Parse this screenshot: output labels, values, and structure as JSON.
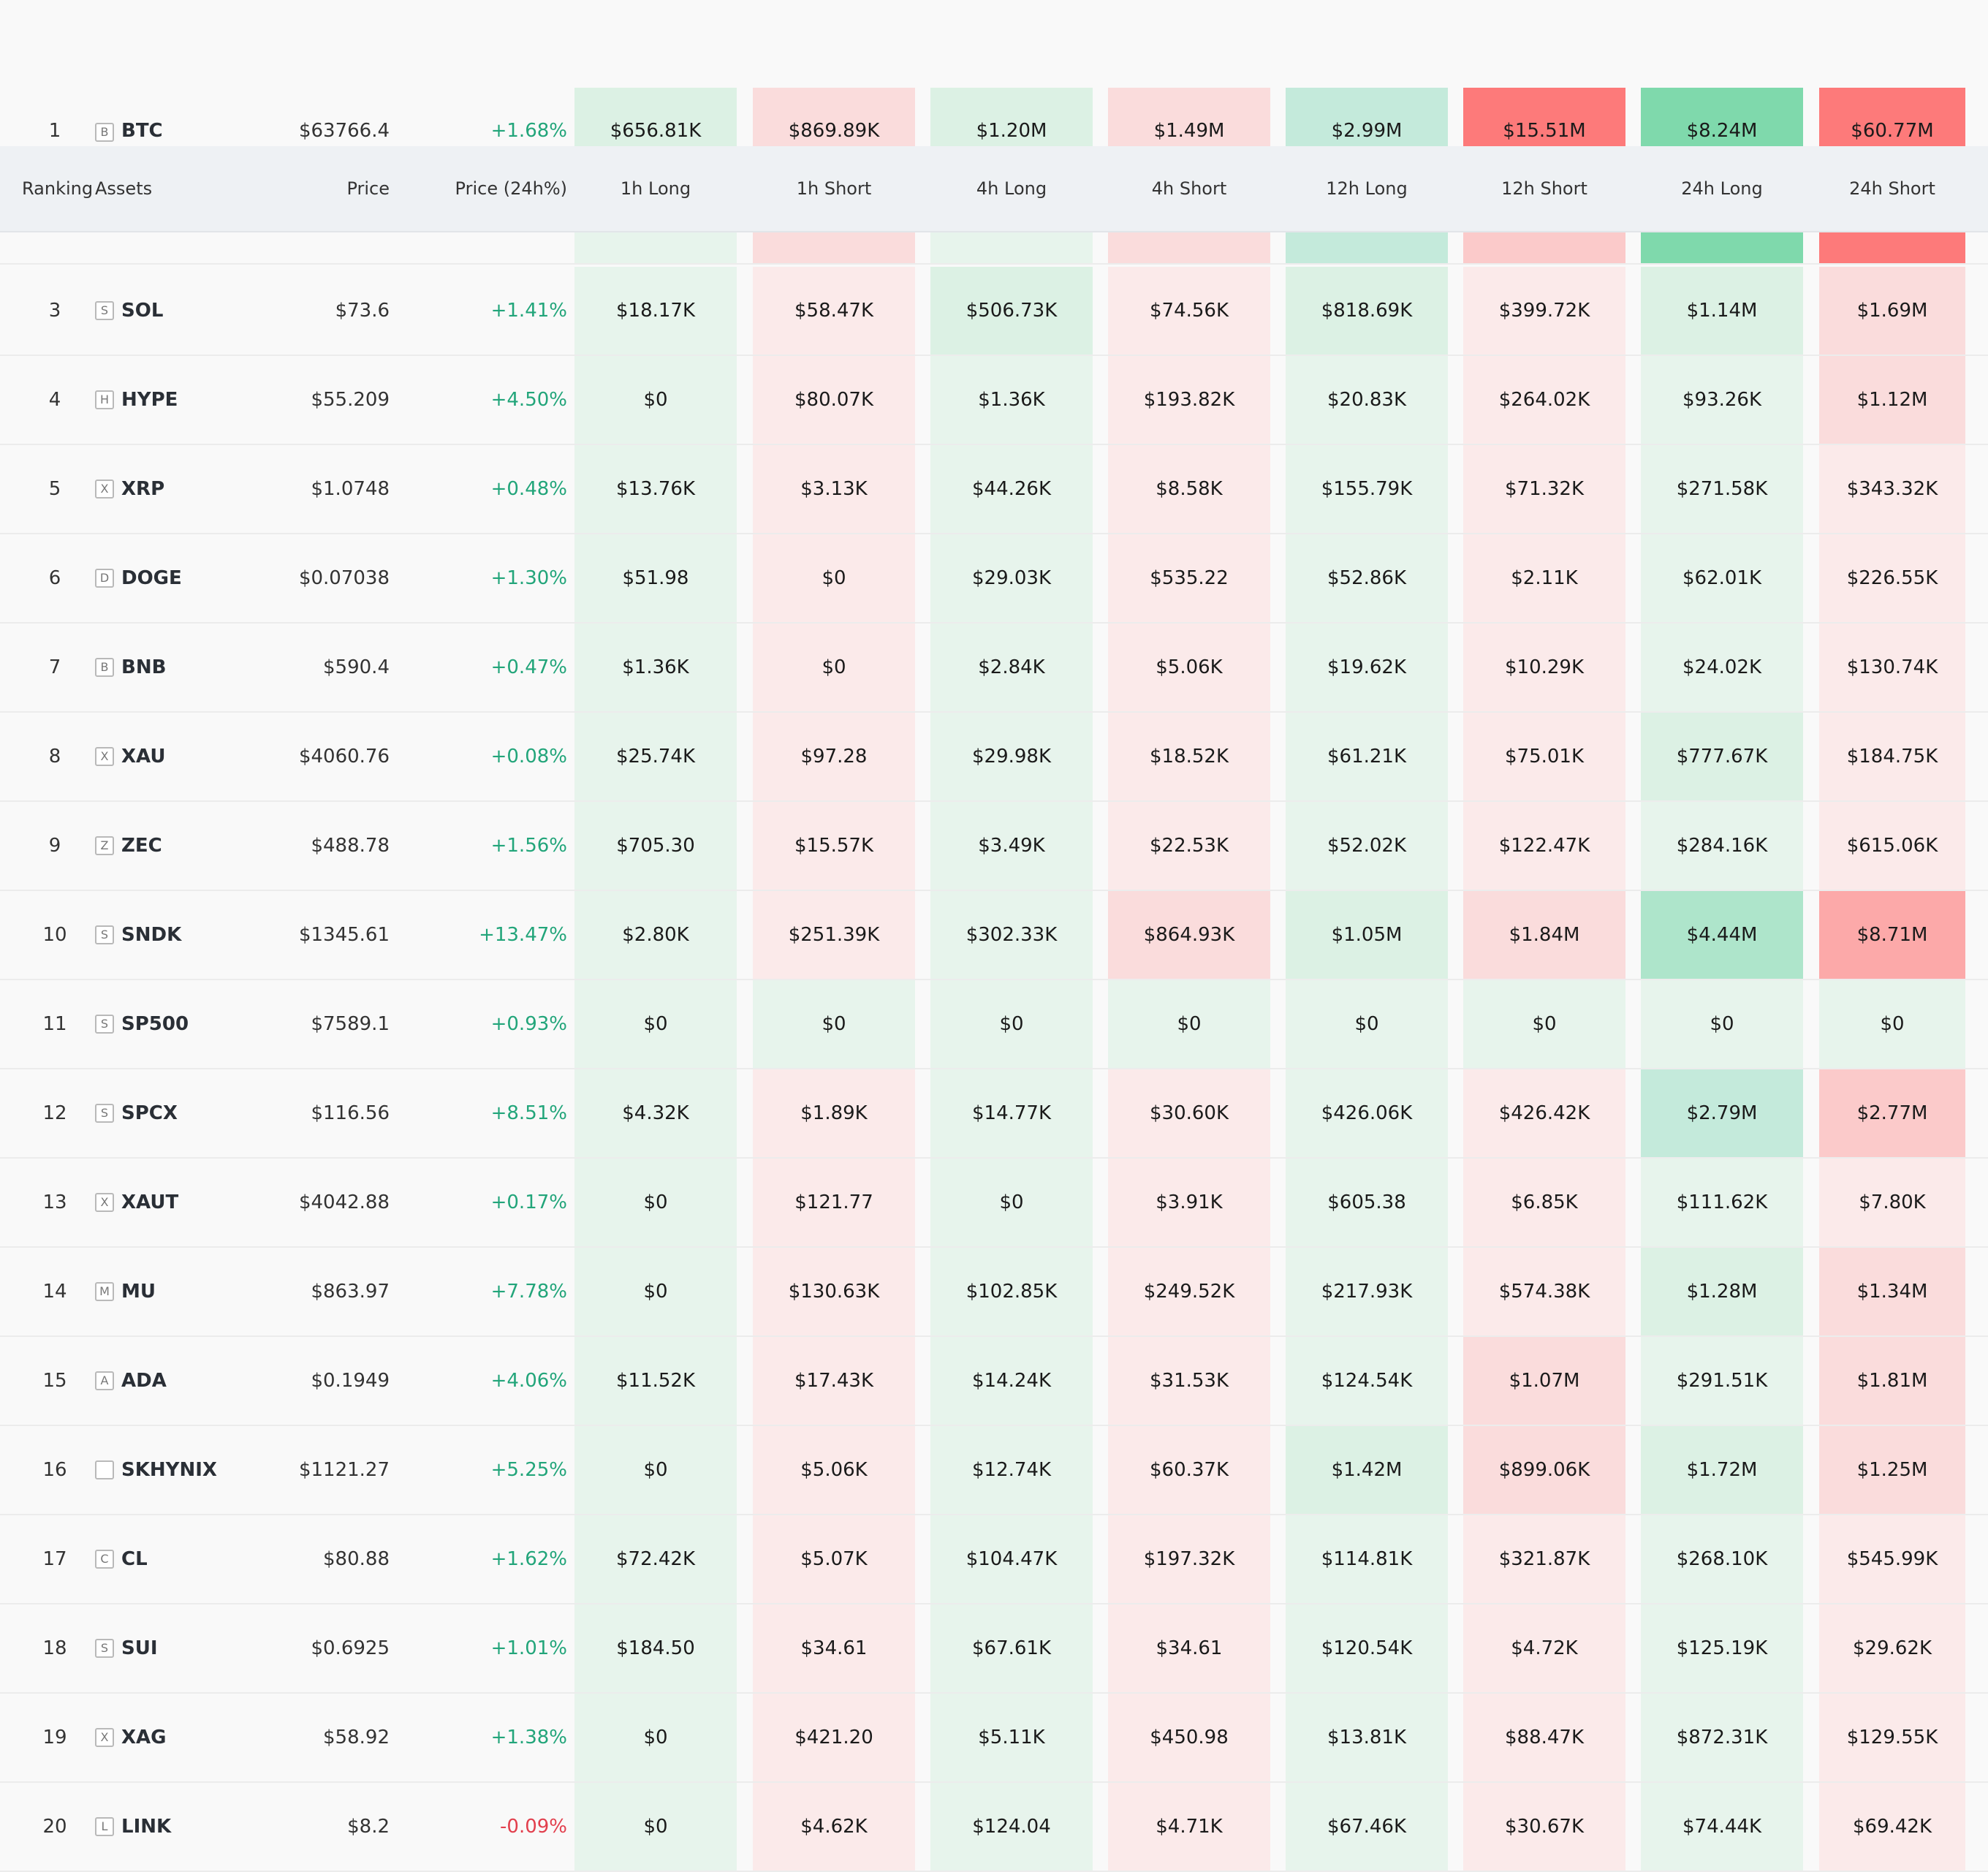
{
  "header": {
    "ranking": "Ranking",
    "assets": "Assets",
    "price": "Price",
    "price_change": "Price (24h%)",
    "h1_long": "1h Long",
    "h1_short": "1h Short",
    "h4_long": "4h Long",
    "h4_short": "4h Short",
    "h12_long": "12h Long",
    "h12_short": "12h Short",
    "h24_long": "24h Long",
    "h24_short": "24h Short"
  },
  "colors": {
    "long_fills": [
      "#e7f4ec",
      "#dcf1e4",
      "#c4eadb",
      "#aee5cb",
      "#7fd9ac"
    ],
    "short_fills": [
      "#fbeaea",
      "#fadcdc",
      "#fbcaca",
      "#fca9a9",
      "#fd7a7a"
    ],
    "positive": "#22a57a",
    "negative": "#e23f4d"
  },
  "rows": [
    {
      "rank": "1",
      "logo": "B",
      "symbol": "BTC",
      "price": "$63766.4",
      "change": "+1.68%",
      "dir": "up",
      "values": [
        "$656.81K",
        "$869.89K",
        "$1.20M",
        "$1.49M",
        "$2.99M",
        "$15.51M",
        "$8.24M",
        "$60.77M"
      ],
      "shade": [
        1,
        1,
        1,
        1,
        2,
        4,
        4,
        4
      ]
    },
    {
      "rank": "",
      "logo": "",
      "symbol": "",
      "price": "",
      "change": "",
      "dir": "up",
      "values": [
        "",
        "",
        "",
        "",
        "",
        "",
        "",
        ""
      ],
      "shade": [
        0,
        1,
        0,
        1,
        2,
        2,
        4,
        4
      ]
    },
    {
      "rank": "3",
      "logo": "S",
      "symbol": "SOL",
      "price": "$73.6",
      "change": "+1.41%",
      "dir": "up",
      "values": [
        "$18.17K",
        "$58.47K",
        "$506.73K",
        "$74.56K",
        "$818.69K",
        "$399.72K",
        "$1.14M",
        "$1.69M"
      ],
      "shade": [
        0,
        0,
        1,
        0,
        1,
        0,
        1,
        1
      ]
    },
    {
      "rank": "4",
      "logo": "H",
      "symbol": "HYPE",
      "price": "$55.209",
      "change": "+4.50%",
      "dir": "up",
      "values": [
        "$0",
        "$80.07K",
        "$1.36K",
        "$193.82K",
        "$20.83K",
        "$264.02K",
        "$93.26K",
        "$1.12M"
      ],
      "shade": [
        0,
        0,
        0,
        0,
        0,
        0,
        0,
        1
      ]
    },
    {
      "rank": "5",
      "logo": "X",
      "symbol": "XRP",
      "price": "$1.0748",
      "change": "+0.48%",
      "dir": "up",
      "values": [
        "$13.76K",
        "$3.13K",
        "$44.26K",
        "$8.58K",
        "$155.79K",
        "$71.32K",
        "$271.58K",
        "$343.32K"
      ],
      "shade": [
        0,
        0,
        0,
        0,
        0,
        0,
        0,
        0
      ]
    },
    {
      "rank": "6",
      "logo": "D",
      "symbol": "DOGE",
      "price": "$0.07038",
      "change": "+1.30%",
      "dir": "up",
      "values": [
        "$51.98",
        "$0",
        "$29.03K",
        "$535.22",
        "$52.86K",
        "$2.11K",
        "$62.01K",
        "$226.55K"
      ],
      "shade": [
        0,
        0,
        0,
        0,
        0,
        0,
        0,
        0
      ]
    },
    {
      "rank": "7",
      "logo": "B",
      "symbol": "BNB",
      "price": "$590.4",
      "change": "+0.47%",
      "dir": "up",
      "values": [
        "$1.36K",
        "$0",
        "$2.84K",
        "$5.06K",
        "$19.62K",
        "$10.29K",
        "$24.02K",
        "$130.74K"
      ],
      "shade": [
        0,
        0,
        0,
        0,
        0,
        0,
        0,
        0
      ]
    },
    {
      "rank": "8",
      "logo": "X",
      "symbol": "XAU",
      "price": "$4060.76",
      "change": "+0.08%",
      "dir": "up",
      "values": [
        "$25.74K",
        "$97.28",
        "$29.98K",
        "$18.52K",
        "$61.21K",
        "$75.01K",
        "$777.67K",
        "$184.75K"
      ],
      "shade": [
        0,
        0,
        0,
        0,
        0,
        0,
        1,
        0
      ]
    },
    {
      "rank": "9",
      "logo": "Z",
      "symbol": "ZEC",
      "price": "$488.78",
      "change": "+1.56%",
      "dir": "up",
      "values": [
        "$705.30",
        "$15.57K",
        "$3.49K",
        "$22.53K",
        "$52.02K",
        "$122.47K",
        "$284.16K",
        "$615.06K"
      ],
      "shade": [
        0,
        0,
        0,
        0,
        0,
        0,
        0,
        0
      ]
    },
    {
      "rank": "10",
      "logo": "S",
      "symbol": "SNDK",
      "price": "$1345.61",
      "change": "+13.47%",
      "dir": "up",
      "values": [
        "$2.80K",
        "$251.39K",
        "$302.33K",
        "$864.93K",
        "$1.05M",
        "$1.84M",
        "$4.44M",
        "$8.71M"
      ],
      "shade": [
        0,
        0,
        0,
        1,
        1,
        1,
        3,
        3
      ]
    },
    {
      "rank": "11",
      "logo": "S",
      "symbol": "SP500",
      "price": "$7589.1",
      "change": "+0.93%",
      "dir": "up",
      "values": [
        "$0",
        "$0",
        "$0",
        "$0",
        "$0",
        "$0",
        "$0",
        "$0"
      ],
      "shade": [
        0,
        -1,
        0,
        -1,
        0,
        -1,
        0,
        -1
      ]
    },
    {
      "rank": "12",
      "logo": "S",
      "symbol": "SPCX",
      "price": "$116.56",
      "change": "+8.51%",
      "dir": "up",
      "values": [
        "$4.32K",
        "$1.89K",
        "$14.77K",
        "$30.60K",
        "$426.06K",
        "$426.42K",
        "$2.79M",
        "$2.77M"
      ],
      "shade": [
        0,
        0,
        0,
        0,
        0,
        0,
        2,
        2
      ]
    },
    {
      "rank": "13",
      "logo": "X",
      "symbol": "XAUT",
      "price": "$4042.88",
      "change": "+0.17%",
      "dir": "up",
      "values": [
        "$0",
        "$121.77",
        "$0",
        "$3.91K",
        "$605.38",
        "$6.85K",
        "$111.62K",
        "$7.80K"
      ],
      "shade": [
        0,
        0,
        0,
        0,
        0,
        0,
        0,
        0
      ]
    },
    {
      "rank": "14",
      "logo": "M",
      "symbol": "MU",
      "price": "$863.97",
      "change": "+7.78%",
      "dir": "up",
      "values": [
        "$0",
        "$130.63K",
        "$102.85K",
        "$249.52K",
        "$217.93K",
        "$574.38K",
        "$1.28M",
        "$1.34M"
      ],
      "shade": [
        0,
        0,
        0,
        0,
        0,
        0,
        1,
        1
      ]
    },
    {
      "rank": "15",
      "logo": "A",
      "symbol": "ADA",
      "price": "$0.1949",
      "change": "+4.06%",
      "dir": "up",
      "values": [
        "$11.52K",
        "$17.43K",
        "$14.24K",
        "$31.53K",
        "$124.54K",
        "$1.07M",
        "$291.51K",
        "$1.81M"
      ],
      "shade": [
        0,
        0,
        0,
        0,
        0,
        1,
        0,
        1
      ]
    },
    {
      "rank": "16",
      "logo": "",
      "symbol": "SKHYNIX",
      "price": "$1121.27",
      "change": "+5.25%",
      "dir": "up",
      "values": [
        "$0",
        "$5.06K",
        "$12.74K",
        "$60.37K",
        "$1.42M",
        "$899.06K",
        "$1.72M",
        "$1.25M"
      ],
      "shade": [
        0,
        0,
        0,
        0,
        1,
        1,
        1,
        1
      ]
    },
    {
      "rank": "17",
      "logo": "C",
      "symbol": "CL",
      "price": "$80.88",
      "change": "+1.62%",
      "dir": "up",
      "values": [
        "$72.42K",
        "$5.07K",
        "$104.47K",
        "$197.32K",
        "$114.81K",
        "$321.87K",
        "$268.10K",
        "$545.99K"
      ],
      "shade": [
        0,
        0,
        0,
        0,
        0,
        0,
        0,
        0
      ]
    },
    {
      "rank": "18",
      "logo": "S",
      "symbol": "SUI",
      "price": "$0.6925",
      "change": "+1.01%",
      "dir": "up",
      "values": [
        "$184.50",
        "$34.61",
        "$67.61K",
        "$34.61",
        "$120.54K",
        "$4.72K",
        "$125.19K",
        "$29.62K"
      ],
      "shade": [
        0,
        0,
        0,
        0,
        0,
        0,
        0,
        0
      ]
    },
    {
      "rank": "19",
      "logo": "X",
      "symbol": "XAG",
      "price": "$58.92",
      "change": "+1.38%",
      "dir": "up",
      "values": [
        "$0",
        "$421.20",
        "$5.11K",
        "$450.98",
        "$13.81K",
        "$88.47K",
        "$872.31K",
        "$129.55K"
      ],
      "shade": [
        0,
        0,
        0,
        0,
        0,
        0,
        0,
        0
      ]
    },
    {
      "rank": "20",
      "logo": "L",
      "symbol": "LINK",
      "price": "$8.2",
      "change": "-0.09%",
      "dir": "down",
      "values": [
        "$0",
        "$4.62K",
        "$124.04",
        "$4.71K",
        "$67.46K",
        "$30.67K",
        "$74.44K",
        "$69.42K"
      ],
      "shade": [
        0,
        0,
        0,
        0,
        0,
        0,
        0,
        0
      ]
    }
  ]
}
